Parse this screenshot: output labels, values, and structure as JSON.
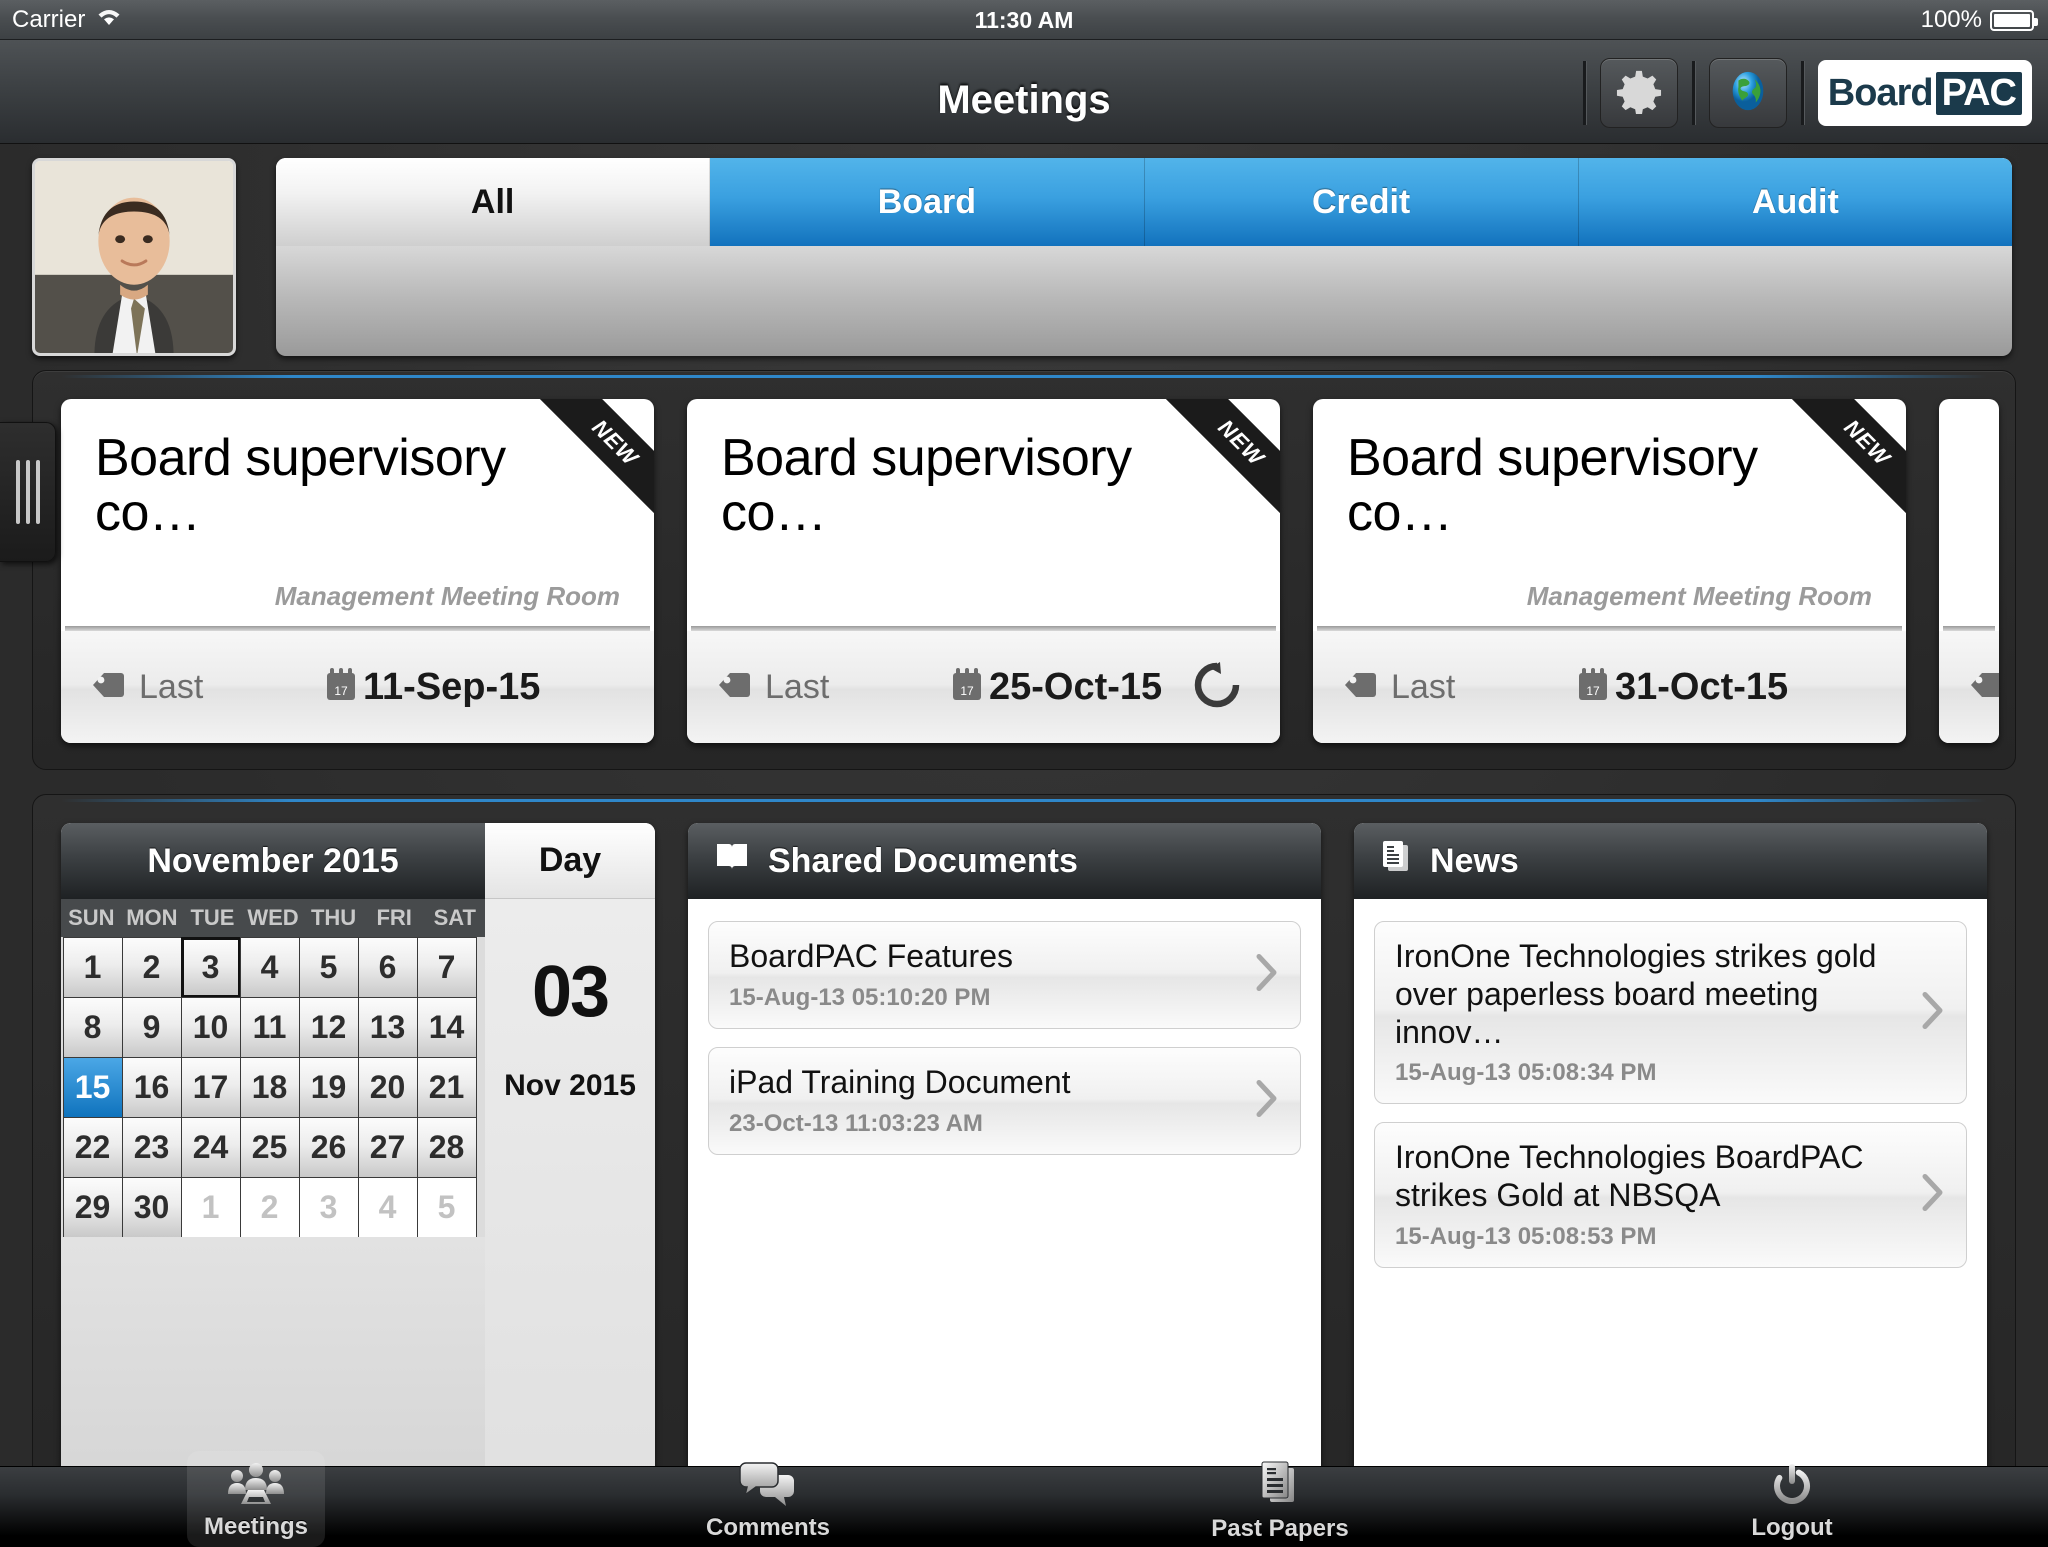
{
  "statusbar": {
    "carrier": "Carrier",
    "wifi_icon": "wifi-icon",
    "time": "11:30 AM",
    "battery_percent": "100%"
  },
  "navbar": {
    "title": "Meetings",
    "settings_icon": "gear-icon",
    "globe_icon": "globe-icon",
    "logo_board": "Board",
    "logo_pac": "PAC"
  },
  "filter_tabs": [
    {
      "label": "All",
      "selected": false
    },
    {
      "label": "Board",
      "selected": true
    },
    {
      "label": "Credit",
      "selected": true
    },
    {
      "label": "Audit",
      "selected": true
    }
  ],
  "meeting_cards": [
    {
      "title": "Board supervisory co…",
      "room": "Management Meeting Room",
      "last_label": "Last",
      "date": "11-Sep-15",
      "badge": "NEW",
      "has_sync": false
    },
    {
      "title": "Board supervisory co…",
      "room": "",
      "last_label": "Last",
      "date": "25-Oct-15",
      "badge": "NEW",
      "has_sync": true
    },
    {
      "title": "Board supervisory co…",
      "room": "Management Meeting Room",
      "last_label": "Last",
      "date": "31-Oct-15",
      "badge": "NEW",
      "has_sync": false
    }
  ],
  "calendar": {
    "title": "November 2015",
    "day_panel_label": "Day",
    "day_number": "03",
    "day_month_year": "Nov 2015",
    "dow": [
      "SUN",
      "MON",
      "TUE",
      "WED",
      "THU",
      "FRI",
      "SAT"
    ],
    "days": [
      {
        "n": "1"
      },
      {
        "n": "2"
      },
      {
        "n": "3",
        "today": true
      },
      {
        "n": "4"
      },
      {
        "n": "5"
      },
      {
        "n": "6"
      },
      {
        "n": "7"
      },
      {
        "n": "8"
      },
      {
        "n": "9"
      },
      {
        "n": "10"
      },
      {
        "n": "11"
      },
      {
        "n": "12"
      },
      {
        "n": "13"
      },
      {
        "n": "14"
      },
      {
        "n": "15",
        "selected": true
      },
      {
        "n": "16"
      },
      {
        "n": "17"
      },
      {
        "n": "18"
      },
      {
        "n": "19"
      },
      {
        "n": "20"
      },
      {
        "n": "21"
      },
      {
        "n": "22"
      },
      {
        "n": "23"
      },
      {
        "n": "24"
      },
      {
        "n": "25"
      },
      {
        "n": "26"
      },
      {
        "n": "27"
      },
      {
        "n": "28"
      },
      {
        "n": "29"
      },
      {
        "n": "30"
      },
      {
        "n": "1",
        "out": true
      },
      {
        "n": "2",
        "out": true
      },
      {
        "n": "3",
        "out": true
      },
      {
        "n": "4",
        "out": true
      },
      {
        "n": "5",
        "out": true
      }
    ]
  },
  "shared_documents": {
    "title": "Shared Documents",
    "icon": "open-book-icon",
    "items": [
      {
        "title": "BoardPAC Features",
        "timestamp": "15-Aug-13 05:10:20 PM"
      },
      {
        "title": "iPad Training Document",
        "timestamp": "23-Oct-13 11:03:23 AM"
      }
    ]
  },
  "news": {
    "title": "News",
    "icon": "documents-icon",
    "items": [
      {
        "title": "IronOne Technologies strikes gold over paperless board meeting innov…",
        "timestamp": "15-Aug-13 05:08:34 PM"
      },
      {
        "title": "IronOne Technologies BoardPAC strikes Gold at NBSQA",
        "timestamp": "15-Aug-13 05:08:53 PM"
      }
    ]
  },
  "tabbar": [
    {
      "label": "Meetings",
      "icon": "meeting-people-icon",
      "active": true
    },
    {
      "label": "Comments",
      "icon": "speech-bubbles-icon",
      "active": false
    },
    {
      "label": "Past Papers",
      "icon": "stacked-papers-icon",
      "active": false
    },
    {
      "label": "Logout",
      "icon": "power-icon",
      "active": false
    }
  ],
  "colors": {
    "accent_blue": "#1272bd",
    "panel_dark": "#2b2b2b"
  }
}
